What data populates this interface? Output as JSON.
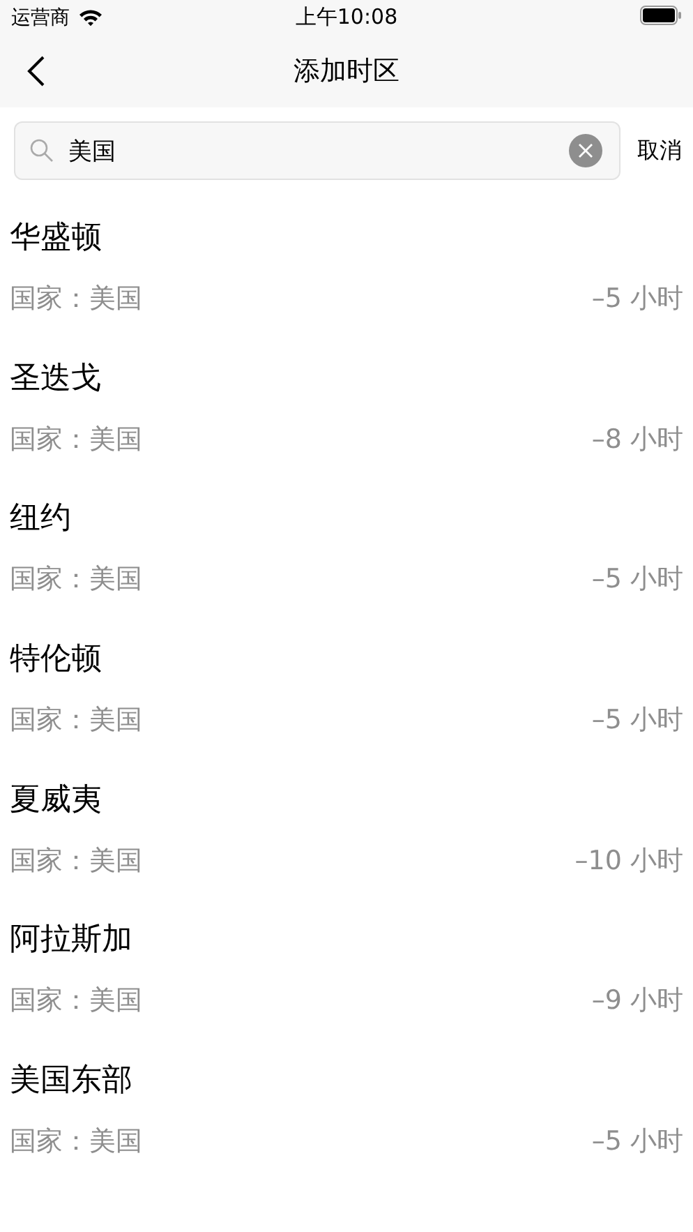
{
  "status_bar": {
    "carrier": "运营商",
    "time": "上午10:08"
  },
  "nav": {
    "title": "添加时区"
  },
  "search": {
    "value": "美国",
    "cancel": "取消"
  },
  "results": [
    {
      "city": "华盛顿",
      "country": "国家：美国",
      "offset": "–5 小时"
    },
    {
      "city": "圣迭戈",
      "country": "国家：美国",
      "offset": "–8 小时"
    },
    {
      "city": "纽约",
      "country": "国家：美国",
      "offset": "–5 小时"
    },
    {
      "city": "特伦顿",
      "country": "国家：美国",
      "offset": "–5 小时"
    },
    {
      "city": "夏威夷",
      "country": "国家：美国",
      "offset": "–10 小时"
    },
    {
      "city": "阿拉斯加",
      "country": "国家：美国",
      "offset": "–9 小时"
    },
    {
      "city": "美国东部",
      "country": "国家：美国",
      "offset": "–5 小时"
    }
  ]
}
